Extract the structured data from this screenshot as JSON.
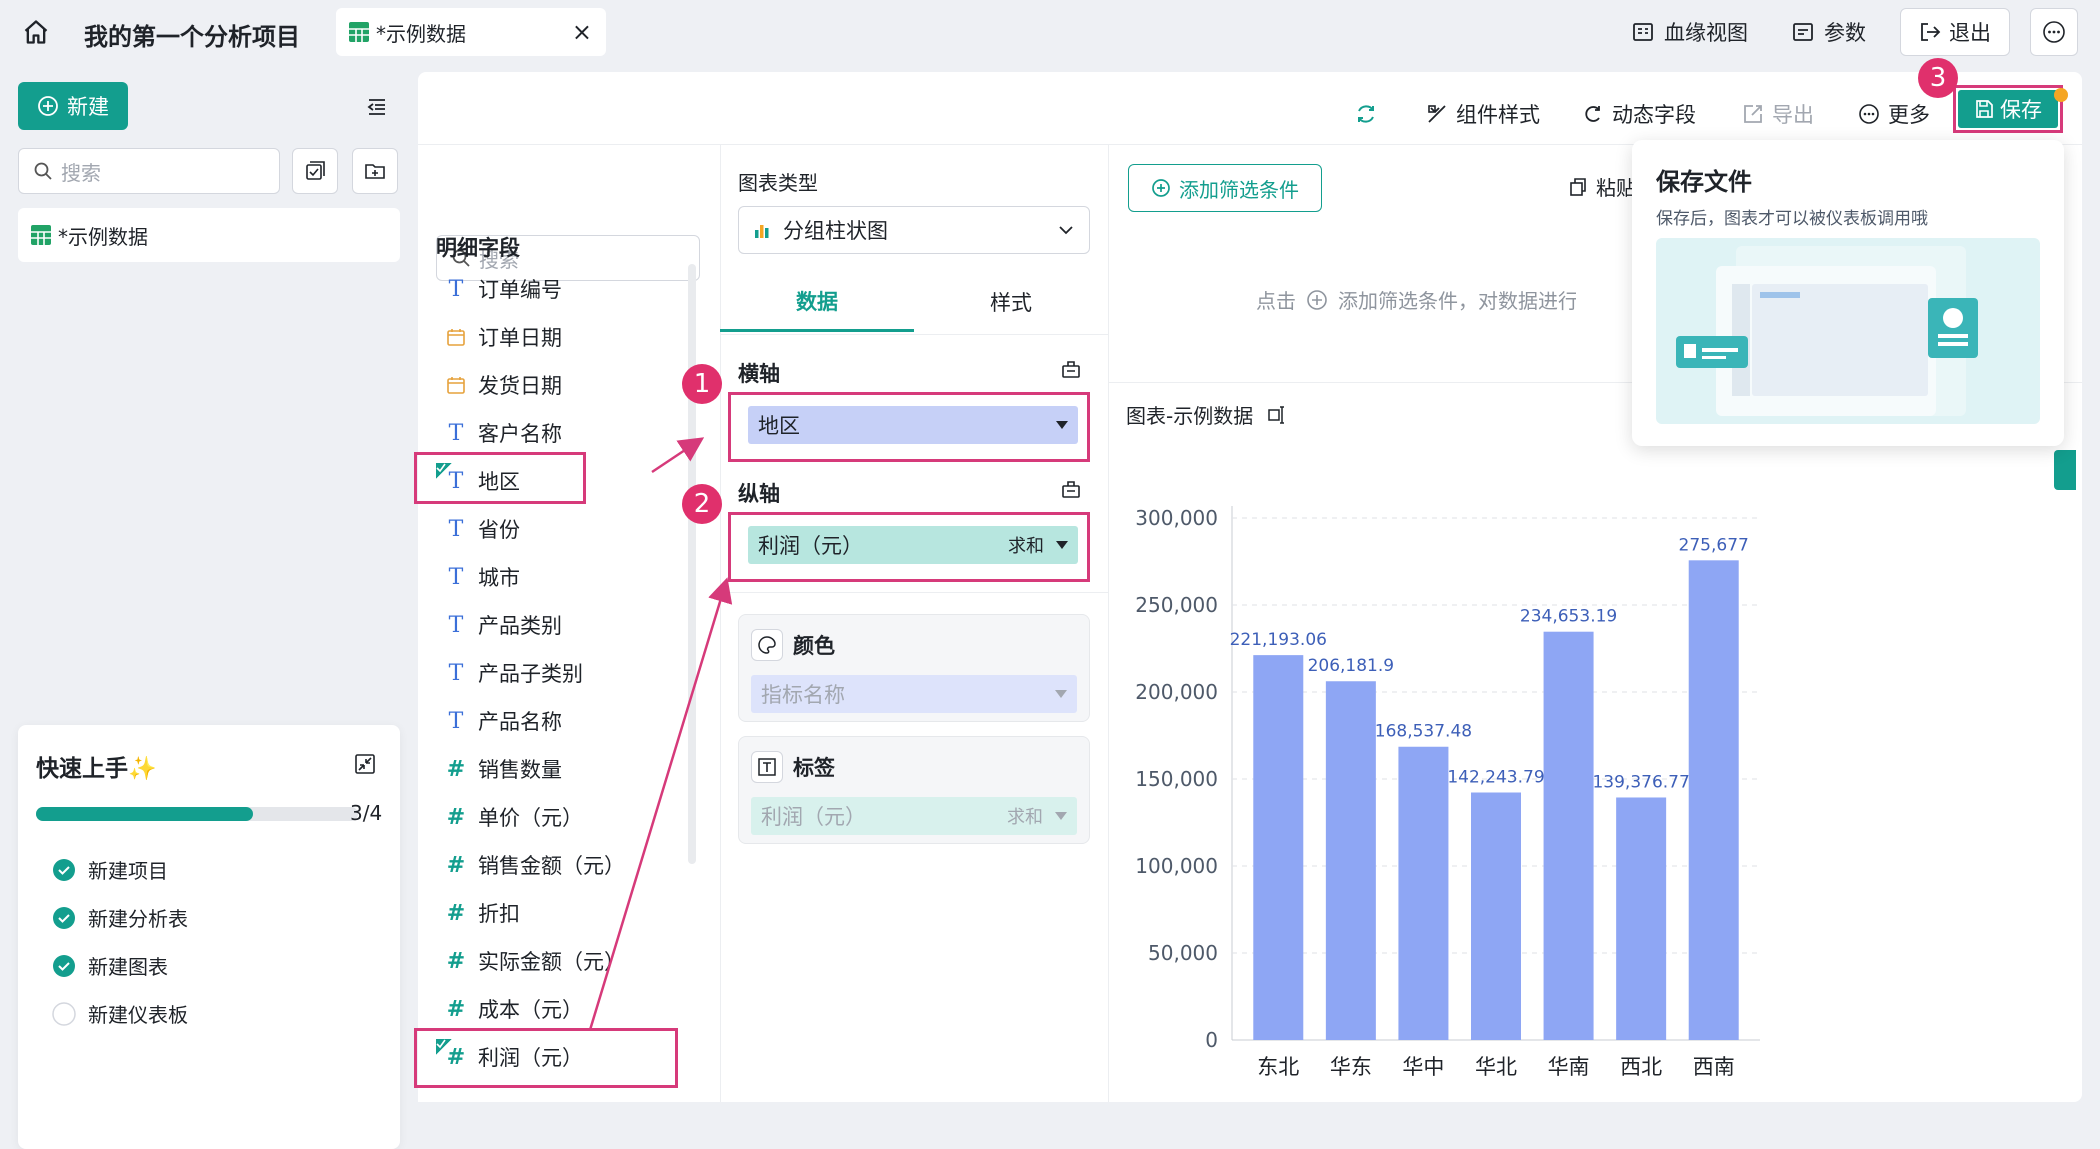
{
  "topbar": {
    "project_title": "我的第一个分析项目",
    "tab_label": "*示例数据",
    "lineage_label": "血缘视图",
    "params_label": "参数",
    "exit_label": "退出"
  },
  "sidebar": {
    "new_label": "新建",
    "search_placeholder": "搜索",
    "tree_item": "*示例数据"
  },
  "quickstart": {
    "title": "快速上手✨",
    "progress_text": "3/4",
    "progress_fraction": 0.75,
    "steps": [
      {
        "label": "新建项目",
        "done": true
      },
      {
        "label": "新建分析表",
        "done": true
      },
      {
        "label": "新建图表",
        "done": true
      },
      {
        "label": "新建仪表板",
        "done": false
      }
    ]
  },
  "toolbar": {
    "style_label": "组件样式",
    "dynamic_label": "动态字段",
    "export_label": "导出",
    "more_label": "更多",
    "save_label": "保存"
  },
  "fields": {
    "search_placeholder": "搜索",
    "section_title": "明细字段",
    "items": [
      {
        "label": "订单编号",
        "type": "T"
      },
      {
        "label": "订单日期",
        "type": "date"
      },
      {
        "label": "发货日期",
        "type": "date"
      },
      {
        "label": "客户名称",
        "type": "T"
      },
      {
        "label": "地区",
        "type": "T"
      },
      {
        "label": "省份",
        "type": "T"
      },
      {
        "label": "城市",
        "type": "T"
      },
      {
        "label": "产品类别",
        "type": "T"
      },
      {
        "label": "产品子类别",
        "type": "T"
      },
      {
        "label": "产品名称",
        "type": "T"
      },
      {
        "label": "销售数量",
        "type": "#"
      },
      {
        "label": "单价（元）",
        "type": "#"
      },
      {
        "label": "销售金额（元）",
        "type": "#"
      },
      {
        "label": "折扣",
        "type": "#"
      },
      {
        "label": "实际金额（元）",
        "type": "#"
      },
      {
        "label": "成本（元）",
        "type": "#"
      },
      {
        "label": "利润（元）",
        "type": "#"
      }
    ]
  },
  "config": {
    "chart_type_label": "图表类型",
    "chart_type_value": "分组柱状图",
    "tab_data": "数据",
    "tab_style": "样式",
    "x_axis_label": "横轴",
    "x_axis_value": "地区",
    "y_axis_label": "纵轴",
    "y_axis_value": "利润（元）",
    "y_axis_agg": "求和",
    "color_label": "颜色",
    "color_value": "指标名称",
    "label_label": "标签",
    "label_value": "利润（元）",
    "label_agg": "求和"
  },
  "badges": [
    "1",
    "2",
    "3"
  ],
  "filter": {
    "add_label": "添加筛选条件",
    "paste_label": "粘贴",
    "hint_prefix": "点击",
    "hint_text": "添加筛选条件，对数据进行筛选"
  },
  "chart_title": "图表-示例数据",
  "save_popup": {
    "title": "保存文件",
    "desc": "保存后，图表才可以被仪表板调用哦"
  },
  "chart_data": {
    "type": "bar",
    "categories": [
      "东北",
      "华东",
      "华中",
      "华北",
      "华南",
      "西北",
      "西南"
    ],
    "series": [
      {
        "name": "利润（元）",
        "values": [
          221193.06,
          206181.9,
          168537.48,
          142243.79,
          234653.19,
          139376.77,
          275677
        ]
      }
    ],
    "data_labels": [
      "221,193.06",
      "206,181.9",
      "168,537.48",
      "142,243.79",
      "234,653.19",
      "139,376.77",
      "275,677"
    ],
    "yticks": [
      "0",
      "50,000",
      "100,000",
      "150,000",
      "200,000",
      "250,000",
      "300,000"
    ],
    "ylim": [
      0,
      300000
    ],
    "legend_title": "指标名称",
    "legend_position": "bottom",
    "bar_color": "#8ea6f4",
    "grid": true
  }
}
